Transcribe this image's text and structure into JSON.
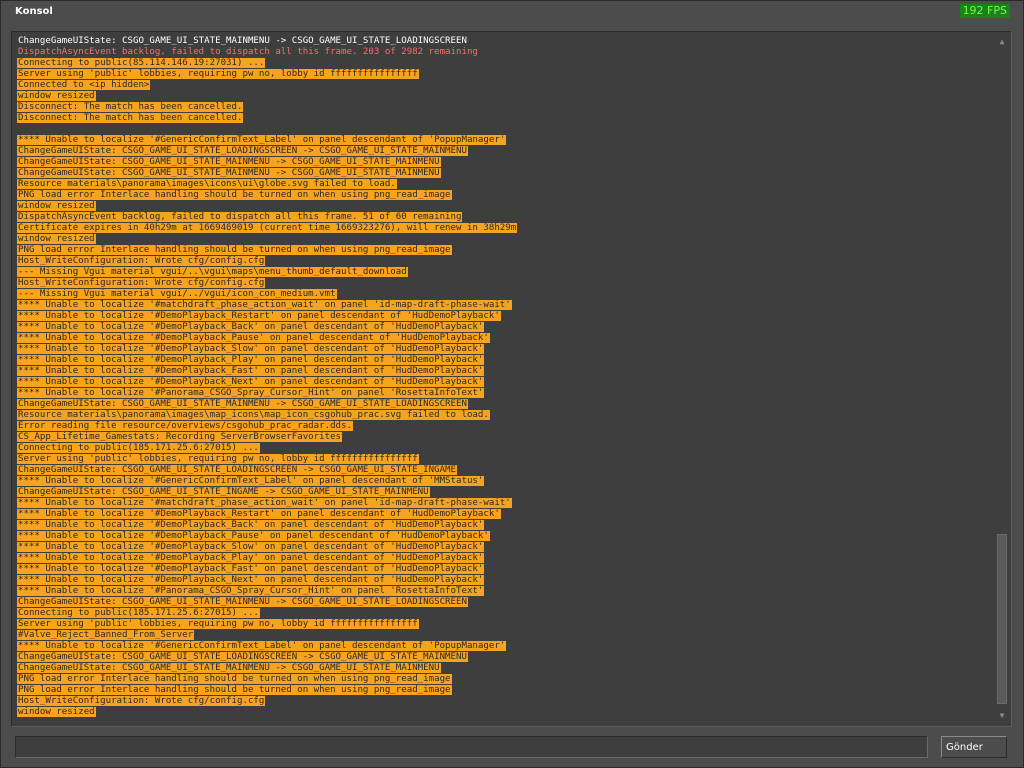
{
  "window": {
    "title": "Konsol",
    "fps": "192 FPS"
  },
  "input": {
    "value": "",
    "placeholder": ""
  },
  "send_button": {
    "label": "Gönder"
  },
  "colors": {
    "highlight": "#f7a31e",
    "error_text": "#ff6b6b",
    "normal_text": "#ffffff",
    "fps_text": "#6dff3e"
  },
  "log_lines": [
    {
      "style": "white",
      "text": "ChangeGameUIState: CSGO_GAME_UI_STATE_MAINMENU -> CSGO_GAME_UI_STATE_LOADINGSCREEN"
    },
    {
      "style": "red",
      "text": "DispatchAsyncEvent backlog, failed to dispatch all this frame. 203 of 2982 remaining"
    },
    {
      "style": "hl",
      "text": "Connecting to public(85.114.146.19:27031) ..."
    },
    {
      "style": "hl",
      "text": "Server using 'public' lobbies, requiring pw no, lobby id ffffffffffffffff"
    },
    {
      "style": "hl",
      "text": "Connected to <ip hidden>"
    },
    {
      "style": "hl",
      "text": "window resized"
    },
    {
      "style": "hl",
      "text": "Disconnect: The match has been cancelled."
    },
    {
      "style": "hl",
      "text": "Disconnect: The match has been cancelled."
    },
    {
      "style": "blank",
      "text": ""
    },
    {
      "style": "hl",
      "text": "**** Unable to localize '#GenericConfirmText_Label' on panel descendant of 'PopupManager'"
    },
    {
      "style": "hl",
      "text": "ChangeGameUIState: CSGO_GAME_UI_STATE_LOADINGSCREEN -> CSGO_GAME_UI_STATE_MAINMENU"
    },
    {
      "style": "hl",
      "text": "ChangeGameUIState: CSGO_GAME_UI_STATE_MAINMENU -> CSGO_GAME_UI_STATE_MAINMENU"
    },
    {
      "style": "hl",
      "text": "ChangeGameUIState: CSGO_GAME_UI_STATE_MAINMENU -> CSGO_GAME_UI_STATE_MAINMENU"
    },
    {
      "style": "hl",
      "text": "Resource materials\\panorama\\images\\icons\\ui\\globe.svg failed to load."
    },
    {
      "style": "hl",
      "text": "PNG load error Interlace handling should be turned on when using png_read_image"
    },
    {
      "style": "hl",
      "text": "window resized"
    },
    {
      "style": "hl",
      "text": "DispatchAsyncEvent backlog, failed to dispatch all this frame. 51 of 60 remaining"
    },
    {
      "style": "hl",
      "text": "Certificate expires in 40h29m at 1669469019 (current time 1669323276), will renew in 38h29m"
    },
    {
      "style": "hl",
      "text": "window resized"
    },
    {
      "style": "hl",
      "text": "PNG load error Interlace handling should be turned on when using png_read_image"
    },
    {
      "style": "hl",
      "text": "Host_WriteConfiguration: Wrote cfg/config.cfg"
    },
    {
      "style": "hl",
      "text": "--- Missing Vgui material vgui/..\\vgui\\maps\\menu_thumb_default_download"
    },
    {
      "style": "hl",
      "text": "Host_WriteConfiguration: Wrote cfg/config.cfg"
    },
    {
      "style": "hl",
      "text": "--- Missing Vgui material vgui/../vgui/icon_con_medium.vmt"
    },
    {
      "style": "hl",
      "text": "**** Unable to localize '#matchdraft_phase_action_wait' on panel 'id-map-draft-phase-wait'"
    },
    {
      "style": "hl",
      "text": "**** Unable to localize '#DemoPlayback_Restart' on panel descendant of 'HudDemoPlayback'"
    },
    {
      "style": "hl",
      "text": "**** Unable to localize '#DemoPlayback_Back' on panel descendant of 'HudDemoPlayback'"
    },
    {
      "style": "hl",
      "text": "**** Unable to localize '#DemoPlayback_Pause' on panel descendant of 'HudDemoPlayback'"
    },
    {
      "style": "hl",
      "text": "**** Unable to localize '#DemoPlayback_Slow' on panel descendant of 'HudDemoPlayback'"
    },
    {
      "style": "hl",
      "text": "**** Unable to localize '#DemoPlayback_Play' on panel descendant of 'HudDemoPlayback'"
    },
    {
      "style": "hl",
      "text": "**** Unable to localize '#DemoPlayback_Fast' on panel descendant of 'HudDemoPlayback'"
    },
    {
      "style": "hl",
      "text": "**** Unable to localize '#DemoPlayback_Next' on panel descendant of 'HudDemoPlayback'"
    },
    {
      "style": "hl",
      "text": "**** Unable to localize '#Panorama_CSGO_Spray_Cursor_Hint' on panel 'RosettaInfoText'"
    },
    {
      "style": "hl",
      "text": "ChangeGameUIState: CSGO_GAME_UI_STATE_MAINMENU -> CSGO_GAME_UI_STATE_LOADINGSCREEN"
    },
    {
      "style": "hl",
      "text": "Resource materials\\panorama\\images\\map_icons\\map_icon_csgohub_prac.svg failed to load."
    },
    {
      "style": "hl",
      "text": "Error reading file resource/overviews/csgohub_prac_radar.dds."
    },
    {
      "style": "hl",
      "text": "CS_App_Lifetime_Gamestats: Recording ServerBrowserFavorites"
    },
    {
      "style": "hl",
      "text": "Connecting to public(185.171.25.6:27015) ..."
    },
    {
      "style": "hl",
      "text": "Server using 'public' lobbies, requiring pw no, lobby id ffffffffffffffff"
    },
    {
      "style": "hl",
      "text": "ChangeGameUIState: CSGO_GAME_UI_STATE_LOADINGSCREEN -> CSGO_GAME_UI_STATE_INGAME"
    },
    {
      "style": "hl",
      "text": "**** Unable to localize '#GenericConfirmText_Label' on panel descendant of 'MMStatus'"
    },
    {
      "style": "hl",
      "text": "ChangeGameUIState: CSGO_GAME_UI_STATE_INGAME -> CSGO_GAME_UI_STATE_MAINMENU"
    },
    {
      "style": "hl",
      "text": "**** Unable to localize '#matchdraft_phase_action_wait' on panel 'id-map-draft-phase-wait'"
    },
    {
      "style": "hl",
      "text": "**** Unable to localize '#DemoPlayback_Restart' on panel descendant of 'HudDemoPlayback'"
    },
    {
      "style": "hl",
      "text": "**** Unable to localize '#DemoPlayback_Back' on panel descendant of 'HudDemoPlayback'"
    },
    {
      "style": "hl",
      "text": "**** Unable to localize '#DemoPlayback_Pause' on panel descendant of 'HudDemoPlayback'"
    },
    {
      "style": "hl",
      "text": "**** Unable to localize '#DemoPlayback_Slow' on panel descendant of 'HudDemoPlayback'"
    },
    {
      "style": "hl",
      "text": "**** Unable to localize '#DemoPlayback_Play' on panel descendant of 'HudDemoPlayback'"
    },
    {
      "style": "hl",
      "text": "**** Unable to localize '#DemoPlayback_Fast' on panel descendant of 'HudDemoPlayback'"
    },
    {
      "style": "hl",
      "text": "**** Unable to localize '#DemoPlayback_Next' on panel descendant of 'HudDemoPlayback'"
    },
    {
      "style": "hl",
      "text": "**** Unable to localize '#Panorama_CSGO_Spray_Cursor_Hint' on panel 'RosettaInfoText'"
    },
    {
      "style": "hl",
      "text": "ChangeGameUIState: CSGO_GAME_UI_STATE_MAINMENU -> CSGO_GAME_UI_STATE_LOADINGSCREEN"
    },
    {
      "style": "hl",
      "text": "Connecting to public(185.171.25.6:27015) ..."
    },
    {
      "style": "hl",
      "text": "Server using 'public' lobbies, requiring pw no, lobby id ffffffffffffffff"
    },
    {
      "style": "hl",
      "text": "#Valve_Reject_Banned_From_Server"
    },
    {
      "style": "hl",
      "text": "**** Unable to localize '#GenericConfirmText_Label' on panel descendant of 'PopupManager'"
    },
    {
      "style": "hl",
      "text": "ChangeGameUIState: CSGO_GAME_UI_STATE_LOADINGSCREEN -> CSGO_GAME_UI_STATE_MAINMENU"
    },
    {
      "style": "hl",
      "text": "ChangeGameUIState: CSGO_GAME_UI_STATE_MAINMENU -> CSGO_GAME_UI_STATE_MAINMENU"
    },
    {
      "style": "hl",
      "text": "PNG load error Interlace handling should be turned on when using png_read_image"
    },
    {
      "style": "hl",
      "text": "PNG load error Interlace handling should be turned on when using png_read_image"
    },
    {
      "style": "hl",
      "text": "Host_WriteConfiguration: Wrote cfg/config.cfg"
    },
    {
      "style": "hl",
      "text": "window resized"
    }
  ]
}
